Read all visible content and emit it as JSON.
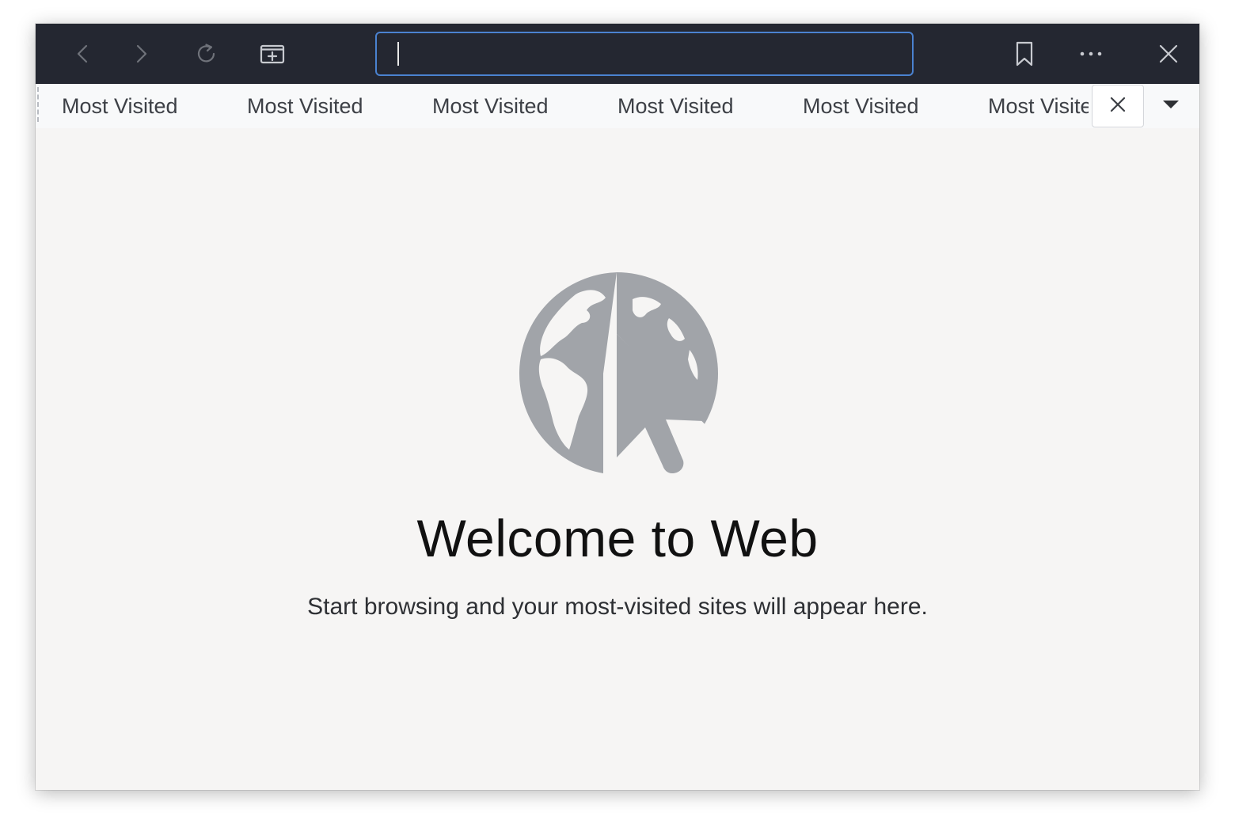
{
  "header": {
    "back_icon": "chevron-left-icon",
    "forward_icon": "chevron-right-icon",
    "reload_icon": "reload-icon",
    "new_tab_icon": "new-tab-icon",
    "bookmark_icon": "bookmark-icon",
    "menu_icon": "more-horizontal-icon",
    "close_icon": "close-icon",
    "url": {
      "value": "",
      "placeholder": ""
    }
  },
  "bookmarks_bar": {
    "items": [
      {
        "label": "Most Visited"
      },
      {
        "label": "Most Visited"
      },
      {
        "label": "Most Visited"
      },
      {
        "label": "Most Visited"
      },
      {
        "label": "Most Visited"
      },
      {
        "label": "Most Visited"
      }
    ],
    "close_icon": "close-icon",
    "overflow_icon": "caret-down-icon"
  },
  "welcome": {
    "logo_icon": "globe-cursor-icon",
    "title": "Welcome to Web",
    "subtitle": "Start browsing and your most-visited sites will appear here."
  },
  "colors": {
    "headerbar_bg": "#242731",
    "url_focus_border": "#4a82d0",
    "content_bg": "#f6f5f4",
    "logo_gray": "#a1a4a9",
    "disabled_icon": "#6f727a",
    "enabled_icon": "#c8cad0"
  }
}
